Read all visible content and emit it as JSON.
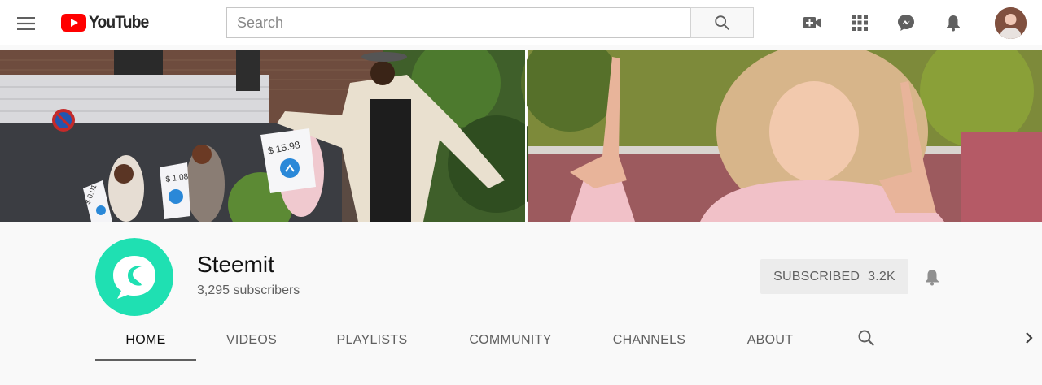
{
  "masthead": {
    "logo_text": "YouTube",
    "logo_color": "#ff0000",
    "search": {
      "placeholder": "Search",
      "value": ""
    },
    "icons": [
      "menu-icon",
      "search-icon",
      "create-video-icon",
      "apps-grid-icon",
      "messages-icon",
      "notifications-bell-icon",
      "account-avatar"
    ]
  },
  "banner": {
    "sign_1": "$ 0.01",
    "sign_2": "$ 1.08",
    "sign_3": "$ 15.98"
  },
  "channel": {
    "name": "Steemit",
    "subscribers": "3,295 subscribers",
    "logo_color": "#1fe0b2",
    "subscribe": {
      "label": "SUBSCRIBED",
      "count": "3.2K"
    }
  },
  "tabs": [
    {
      "label": "HOME",
      "active": true
    },
    {
      "label": "VIDEOS",
      "active": false
    },
    {
      "label": "PLAYLISTS",
      "active": false
    },
    {
      "label": "COMMUNITY",
      "active": false
    },
    {
      "label": "CHANNELS",
      "active": false
    },
    {
      "label": "ABOUT",
      "active": false
    }
  ]
}
